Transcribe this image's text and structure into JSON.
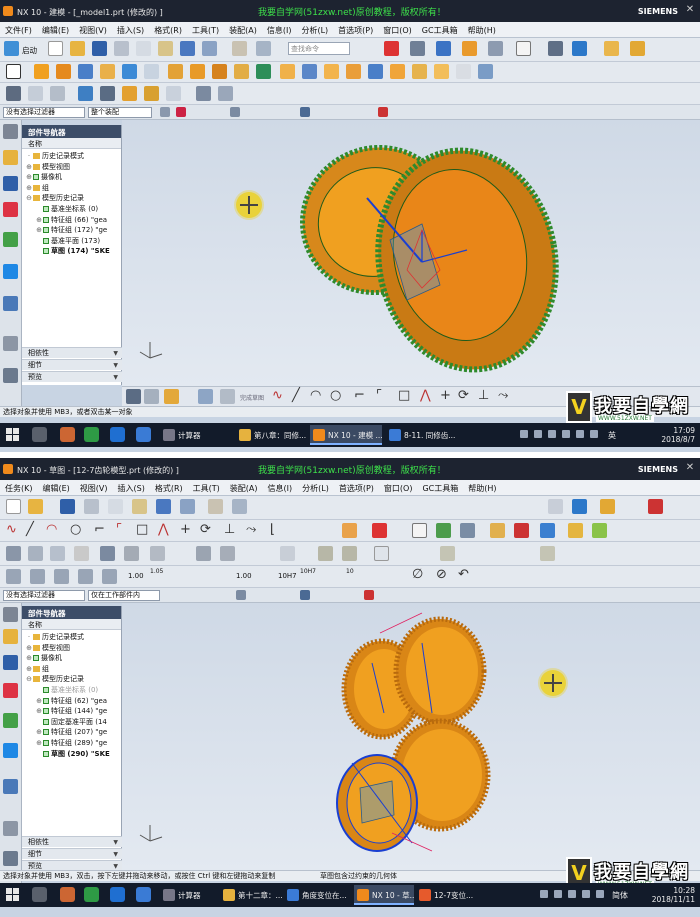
{
  "shot1": {
    "title": "NX 10 - 建模 - [_model1.prt  (修改的)  ]",
    "watermark": "我要自学网(51zxw.net)原创教程，版权所有！",
    "brand": "SIEMENS",
    "menu": [
      "文件(F)",
      "编辑(E)",
      "视图(V)",
      "插入(S)",
      "格式(R)",
      "工具(T)",
      "装配(A)",
      "信息(I)",
      "分析(L)",
      "首选项(P)",
      "窗口(O)",
      "GC工具箱",
      "帮助(H)"
    ],
    "launch_label": "启动",
    "search_placeholder": "查找命令",
    "filter_select": "没有选择过滤器",
    "assembly_select": "整个装配",
    "navigator_title": "部件导航器",
    "column_name": "名称",
    "tree": [
      {
        "label": "历史记录模式",
        "icon": "history-icon"
      },
      {
        "label": "模型视图",
        "icon": "model-views-icon"
      },
      {
        "label": "摄像机",
        "icon": "camera-icon"
      },
      {
        "label": "组",
        "icon": "group-icon"
      },
      {
        "label": "模型历史记录",
        "icon": "folder-icon"
      },
      {
        "label": "基准坐标系 (0)",
        "icon": "datum-csys-icon"
      },
      {
        "label": "特征组 (66) \"gea",
        "icon": "feature-group-icon"
      },
      {
        "label": "特征组 (172) \"ge",
        "icon": "feature-group-icon"
      },
      {
        "label": "基准平面 (173)",
        "icon": "datum-plane-icon"
      },
      {
        "label": "草图 (174) \"SKE",
        "icon": "sketch-icon"
      }
    ],
    "sections": [
      "相依性",
      "细节",
      "预览"
    ],
    "sketch_label": "完成草图",
    "status": "选择对象并使用 MB3，或者双击某一对象",
    "status_mid": "",
    "taskbar": [
      {
        "label": "计算器",
        "active": false
      },
      {
        "label": "第八章：同修...",
        "active": false
      },
      {
        "label": "NX 10 - 建模 ...",
        "active": true
      },
      {
        "label": "8-11. 同修齿...",
        "active": false
      }
    ],
    "lang": "英",
    "time": "17:09",
    "date": "2018/8/7"
  },
  "shot2": {
    "title": "NX 10 - 草图 - [12-7齿轮模型.prt  (修改的)  ]",
    "watermark": "我要自学网(51zxw.net)原创教程，版权所有！",
    "brand": "SIEMENS",
    "menu": [
      "任务(K)",
      "编辑(E)",
      "视图(V)",
      "插入(S)",
      "格式(R)",
      "工具(T)",
      "装配(A)",
      "信息(I)",
      "分析(L)",
      "首选项(P)",
      "窗口(O)",
      "GC工具箱",
      "帮助(H)"
    ],
    "filter_select": "没有选择过滤器",
    "assembly_select": "仅在工作部件内",
    "navigator_title": "部件导航器",
    "column_name": "名称",
    "tree": [
      {
        "label": "历史记录模式",
        "icon": "history-icon"
      },
      {
        "label": "模型视图",
        "icon": "model-views-icon"
      },
      {
        "label": "摄像机",
        "icon": "camera-icon"
      },
      {
        "label": "组",
        "icon": "group-icon"
      },
      {
        "label": "模型历史记录",
        "icon": "folder-icon"
      },
      {
        "label": "基准坐标系 (0)",
        "icon": "datum-csys-icon"
      },
      {
        "label": "特征组 (62) \"gea",
        "icon": "feature-group-icon"
      },
      {
        "label": "特征组 (144) \"ge",
        "icon": "feature-group-icon"
      },
      {
        "label": "固定基准平面 (14",
        "icon": "datum-plane-icon"
      },
      {
        "label": "特征组 (207) \"ge",
        "icon": "feature-group-icon"
      },
      {
        "label": "特征组 (289) \"ge",
        "icon": "feature-group-icon"
      },
      {
        "label": "草图 (290) \"SKE",
        "icon": "sketch-icon"
      }
    ],
    "sections": [
      "相依性",
      "细节",
      "预览"
    ],
    "dims": [
      "1.00",
      "1.05",
      "1.00",
      "10H7",
      "10H7",
      "10"
    ],
    "status": "选择对象并使用 MB3，双击，按下左键并拖动来移动，或按住 Ctrl 键和左键拖动来复制",
    "status_mid": "草图包含过约束的几何体",
    "taskbar": [
      {
        "label": "计算器",
        "active": false
      },
      {
        "label": "第十二章：...",
        "active": false
      },
      {
        "label": "角度变位在...",
        "active": false
      },
      {
        "label": "NX 10 - 草...",
        "active": true
      },
      {
        "label": "12-7变位...",
        "active": false
      }
    ],
    "lang": "简体",
    "time": "10:28",
    "date": "2018/11/11"
  },
  "logo_text": "我要自學網",
  "logo_url": "WWW.51ZXW.NET",
  "colors": {
    "gear": "#f0a020",
    "gear_face": "#e98618",
    "teeth_outline": "#2f8a2c",
    "sketch": "#1a3fd1",
    "taskbar": "#121b2a"
  }
}
